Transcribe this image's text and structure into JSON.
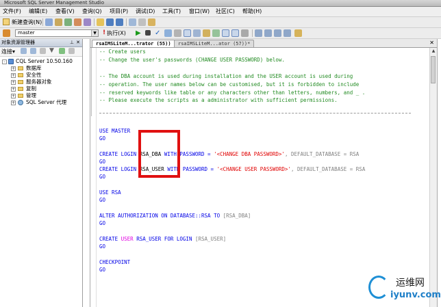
{
  "window": {
    "title": "Microsoft SQL Server Management Studio"
  },
  "menu": [
    "文件(F)",
    "编辑(E)",
    "查看(V)",
    "查询(Q)",
    "项目(P)",
    "调试(D)",
    "工具(T)",
    "窗口(W)",
    "社区(C)",
    "帮助(H)"
  ],
  "toolbar": {
    "new_query_label": "新建查询(N)",
    "database": "master",
    "execute_label": "执行(X)"
  },
  "object_explorer": {
    "title": "对象资源管理器",
    "connect_label": "连接",
    "tree": [
      {
        "label": "CQL Server 10.50.160",
        "icon": "server-icon",
        "expander": "-"
      },
      {
        "label": "数据库",
        "icon": "folder-icon",
        "expander": "+"
      },
      {
        "label": "安全性",
        "icon": "folder-icon",
        "expander": "+"
      },
      {
        "label": "服务器对象",
        "icon": "folder-icon",
        "expander": "+"
      },
      {
        "label": "复制",
        "icon": "folder-icon",
        "expander": "+"
      },
      {
        "label": "管理",
        "icon": "folder-icon",
        "expander": "+"
      },
      {
        "label": "SQL Server 代理",
        "icon": "agent-icon",
        "expander": "+"
      }
    ]
  },
  "tabs": [
    {
      "label": "rsaIMSLiteM...trator (55))",
      "active": true
    },
    {
      "label": "rsaIMSLiteM...ator (57))*",
      "active": false
    }
  ],
  "code": {
    "comment1": "-- Create users",
    "comment2": "-- Change the user's passwords (CHANGE USER PASSWORD) below.",
    "comment3": "-- The DBA account is used during installation and the USER account is used during",
    "comment4": "-- operation. The user names below can be customised, but it is forbidden to include",
    "comment5": "-- reserved keywords like table or any characters other than letters, numbers, and _ .",
    "comment6": "-- Please execute the scripts as a administrator with sufficient permissions.",
    "use_master": "USE MASTER",
    "go": "GO",
    "create_login": "CREATE LOGIN",
    "rsa_dba": "RSA_DBA",
    "rsa_user": "RSA_USER",
    "with_password": "WITH PASSWORD =",
    "dba_pwd": "'<CHANGE DBA PASSWORD>'",
    "user_pwd": "'<CHANGE USER PASSWORD>'",
    "default_db": ", DEFAULT_DATABASE = RSA",
    "use_rsa": "USE RSA",
    "alter_auth": "ALTER AUTHORIZATION ON DATABASE::RSA TO",
    "alter_target": "[RSA_DBA]",
    "create": "CREATE",
    "user_kw": "USER",
    "create_user_rest": "RSA_USER FOR LOGIN",
    "login_target": "[RSA_USER]",
    "checkpoint": "CHECKPOINT"
  },
  "watermark": {
    "cn": "运维网",
    "url": "iyunv.com"
  }
}
